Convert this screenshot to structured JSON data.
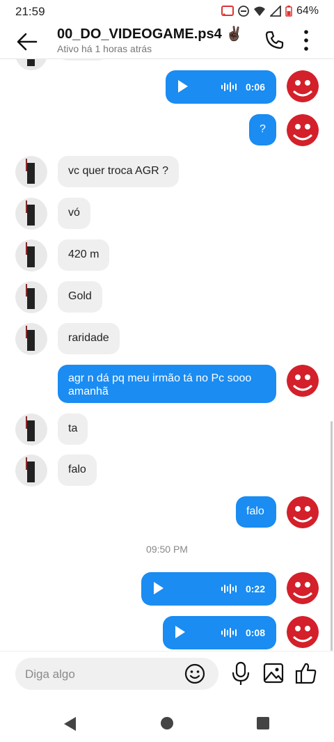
{
  "status": {
    "time": "21:59",
    "battery": "64%"
  },
  "header": {
    "title": "00_DO_VIDEOGAME.ps4 ✌🏿",
    "subtitle": "Ativo há 1 horas atrás"
  },
  "messages": {
    "audio1_duration": "0:06",
    "out_q": "?",
    "in_1": "vc quer troca AGR ?",
    "in_2": "vó",
    "in_3": "420 m",
    "in_4": "Gold",
    "in_5": "raridade",
    "out_long": "agr n dá pq meu irmão tá no Pc sooo amanhã",
    "in_6": "ta",
    "in_7": "falo",
    "out_falo": "falo",
    "timestamp": "09:50 PM",
    "audio2_duration": "0:22",
    "audio3_duration": "0:08"
  },
  "composer": {
    "placeholder": "Diga algo"
  },
  "colors": {
    "accent": "#1a8cf2",
    "incoming_bubble": "#efefef",
    "avatar_red": "#d3202a"
  },
  "icons": {
    "back": "arrow-left-icon",
    "call": "phone-icon",
    "more": "more-vertical-icon",
    "emoji": "emoji-icon",
    "mic": "microphone-icon",
    "image": "image-icon",
    "like": "thumbs-up-icon"
  }
}
